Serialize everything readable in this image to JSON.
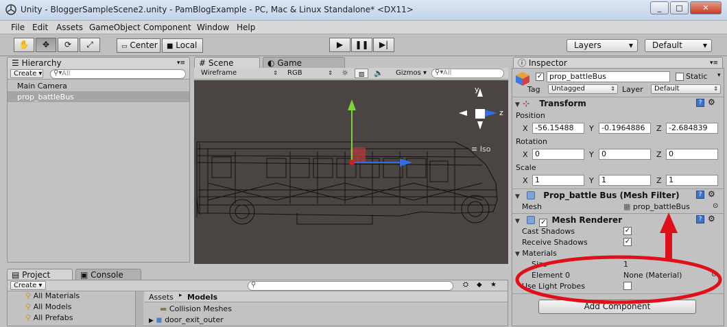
{
  "window": {
    "title": "Unity - BloggerSampleScene2.unity - PamBlogExample - PC, Mac & Linux Standalone* <DX11>",
    "controls": [
      "_",
      "□",
      "✕"
    ]
  },
  "menu": [
    "File",
    "Edit",
    "Assets",
    "GameObject",
    "Component",
    "Window",
    "Help"
  ],
  "toolbar": {
    "tools": [
      "hand",
      "move",
      "rotate",
      "scale"
    ],
    "pivot": "Center",
    "space": "Local",
    "layers": "Layers",
    "layout": "Default"
  },
  "hierarchy": {
    "tab": "Hierarchy",
    "create": "Create",
    "search_placeholder": "All",
    "items": [
      "Main Camera",
      "prop_battleBus"
    ]
  },
  "scene": {
    "tab_scene": "Scene",
    "tab_game": "Game",
    "render_mode": "Wireframe",
    "color_mode": "RGB",
    "gizmos": "Gizmos",
    "search_placeholder": "All",
    "gizmo_y": "y",
    "gizmo_z": "z",
    "projection": "Iso"
  },
  "project": {
    "tab_project": "Project",
    "tab_console": "Console",
    "create": "Create",
    "favorites": [
      "All Materials",
      "All Models",
      "All Prefabs"
    ],
    "breadcrumb_root": "Assets",
    "breadcrumb_leaf": "Models",
    "assets": [
      "Collision Meshes",
      "door_exit_outer"
    ]
  },
  "inspector": {
    "tab": "Inspector",
    "object_name": "prop_battleBus",
    "static_label": "Static",
    "tag_label": "Tag",
    "tag_value": "Untagged",
    "layer_label": "Layer",
    "layer_value": "Default",
    "transform": {
      "title": "Transform",
      "position_label": "Position",
      "rotation_label": "Rotation",
      "scale_label": "Scale",
      "position": {
        "x": "-56.15488",
        "y": "-0.1964886",
        "z": "-2.684839"
      },
      "rotation": {
        "x": "0",
        "y": "0",
        "z": "0"
      },
      "scale": {
        "x": "1",
        "y": "1",
        "z": "1"
      }
    },
    "mesh_filter": {
      "title": "Prop_battle Bus (Mesh Filter)",
      "mesh_label": "Mesh",
      "mesh_value": "prop_battleBus"
    },
    "mesh_renderer": {
      "title": "Mesh Renderer",
      "cast_shadows": "Cast Shadows",
      "receive_shadows": "Receive Shadows",
      "materials": "Materials",
      "size_label": "Size",
      "size_value": "1",
      "element_label": "Element 0",
      "element_value": "None (Material)",
      "light_probes": "Use Light Probes"
    },
    "add_component": "Add Component"
  },
  "colors": {
    "annotation_red": "#e0101a",
    "gizmo_y": "#7fd23a",
    "gizmo_z": "#2f6fe6",
    "gizmo_x": "#d22020",
    "viewport_bg": "#4a4542"
  }
}
